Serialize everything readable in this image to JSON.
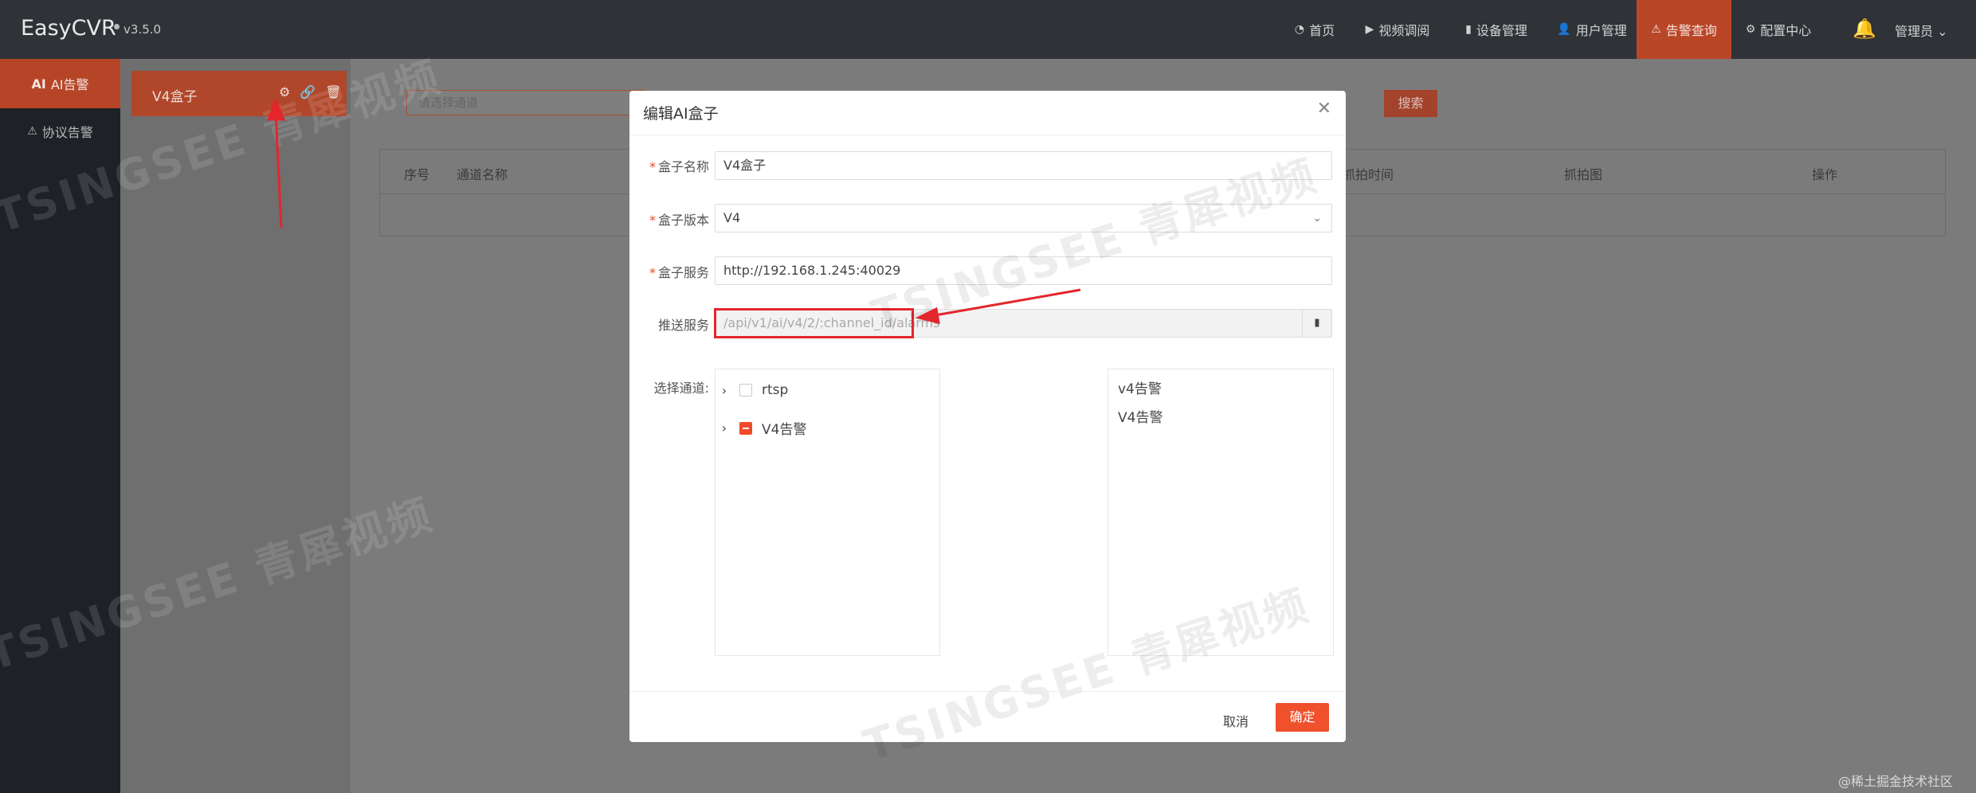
{
  "app": {
    "title": "EasyCVR",
    "version": "v3.5.0"
  },
  "nav": [
    {
      "label": "首页",
      "icon": "dashboard-icon"
    },
    {
      "label": "视频调阅",
      "icon": "play-icon"
    },
    {
      "label": "设备管理",
      "icon": "device-icon"
    },
    {
      "label": "用户管理",
      "icon": "user-icon"
    },
    {
      "label": "告警查询",
      "icon": "alarm-icon",
      "active": true
    },
    {
      "label": "配置中心",
      "icon": "gear-icon"
    }
  ],
  "user": {
    "label": "管理员"
  },
  "sidebar": {
    "items": [
      {
        "label": "AI告警",
        "prefix": "AI",
        "active": true
      },
      {
        "label": "协议告警",
        "active": false
      }
    ]
  },
  "box_list": {
    "items": [
      {
        "name": "V4盒子"
      }
    ]
  },
  "filter": {
    "placeholder": "请选择通道",
    "search_label": "搜索"
  },
  "table": {
    "columns": [
      "序号",
      "通道名称",
      "抓拍时间",
      "抓拍图",
      "操作"
    ],
    "rows": []
  },
  "dialog": {
    "title": "编辑AI盒子",
    "fields": {
      "name": {
        "label": "盒子名称",
        "value": "V4盒子",
        "required": true
      },
      "version": {
        "label": "盒子版本",
        "value": "V4",
        "required": true
      },
      "service": {
        "label": "盒子服务",
        "value": "http://192.168.1.245:40029",
        "required": true
      },
      "push": {
        "label": "推送服务",
        "value": "/api/v1/ai/v4/2/:channel_id/alarms",
        "required": false
      },
      "channels": {
        "label": "选择通道:"
      }
    },
    "tree": [
      {
        "label": "rtsp",
        "checked": "none"
      },
      {
        "label": "V4告警",
        "checked": "partial"
      }
    ],
    "selected": [
      "v4告警",
      "V4告警"
    ],
    "cancel_label": "取消",
    "ok_label": "确定"
  },
  "watermark": {
    "text": "TSINGSEE 青犀视频"
  },
  "credit": "@稀土掘金技术社区",
  "colors": {
    "accent": "#f0502c",
    "active_nav": "#ba4628",
    "highlight": "#e3262c"
  }
}
